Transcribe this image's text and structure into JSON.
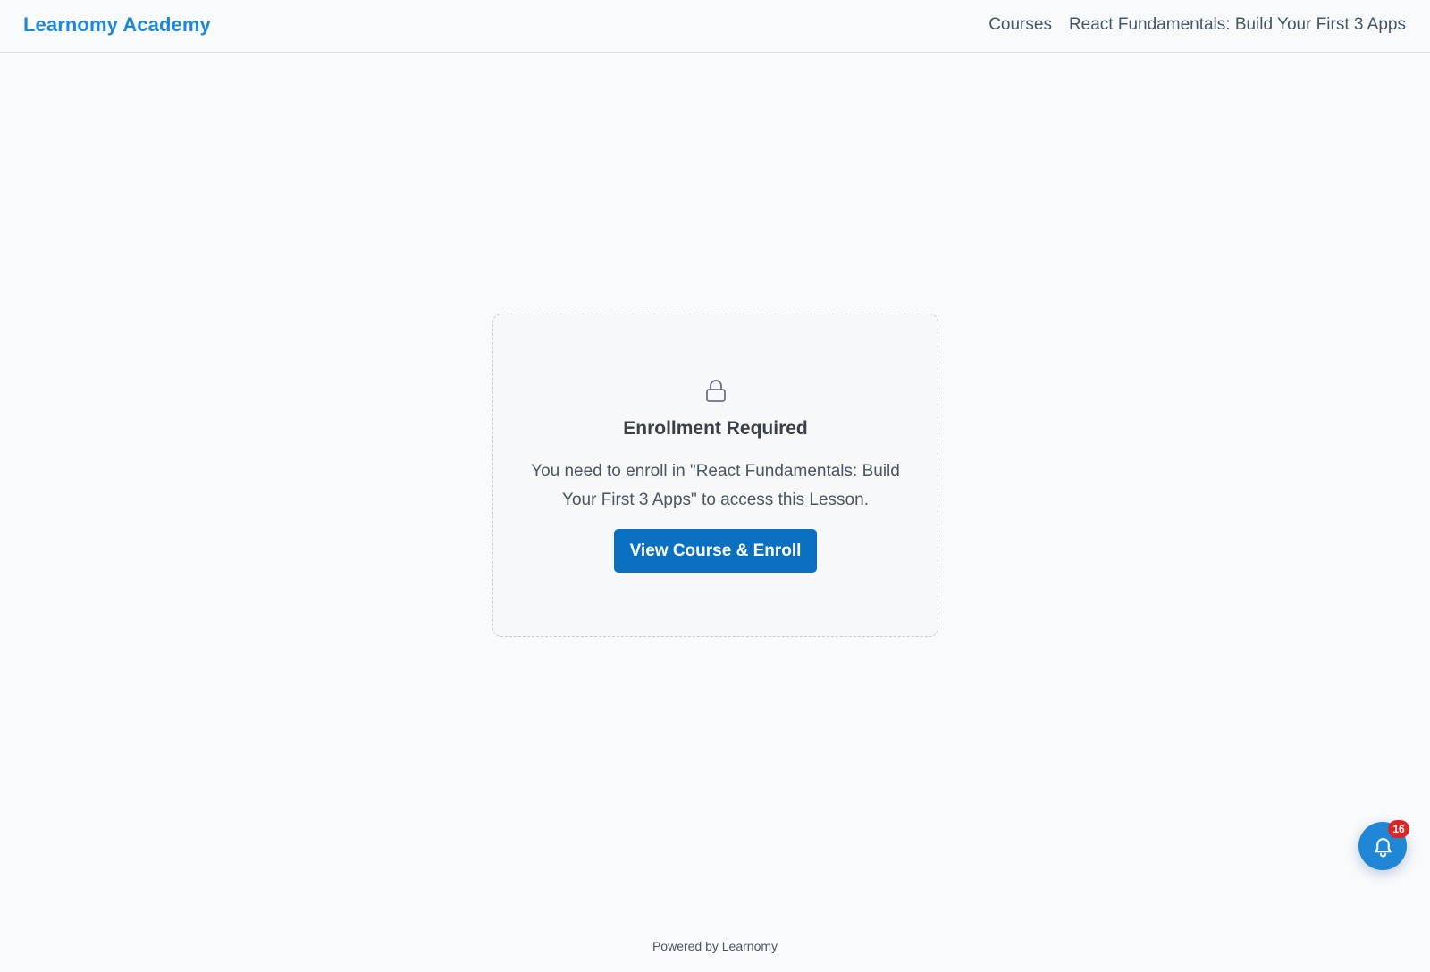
{
  "header": {
    "brand": "Learnomy Academy",
    "nav": {
      "courses": "Courses",
      "course_title": "React Fundamentals: Build Your First 3 Apps"
    }
  },
  "enrollment_card": {
    "icon": "lock-icon",
    "title": "Enrollment Required",
    "message": "You need to enroll in \"React Fundamentals: Build Your First 3 Apps\" to access this Lesson.",
    "button_label": "View Course & Enroll"
  },
  "notifications": {
    "icon": "bell-icon",
    "count": "16"
  },
  "footer": {
    "text": "Powered by Learnomy"
  },
  "colors": {
    "brand": "#1e88d8",
    "button": "#0b6fc0",
    "badge": "#dc2626",
    "background": "#f8fafc"
  }
}
